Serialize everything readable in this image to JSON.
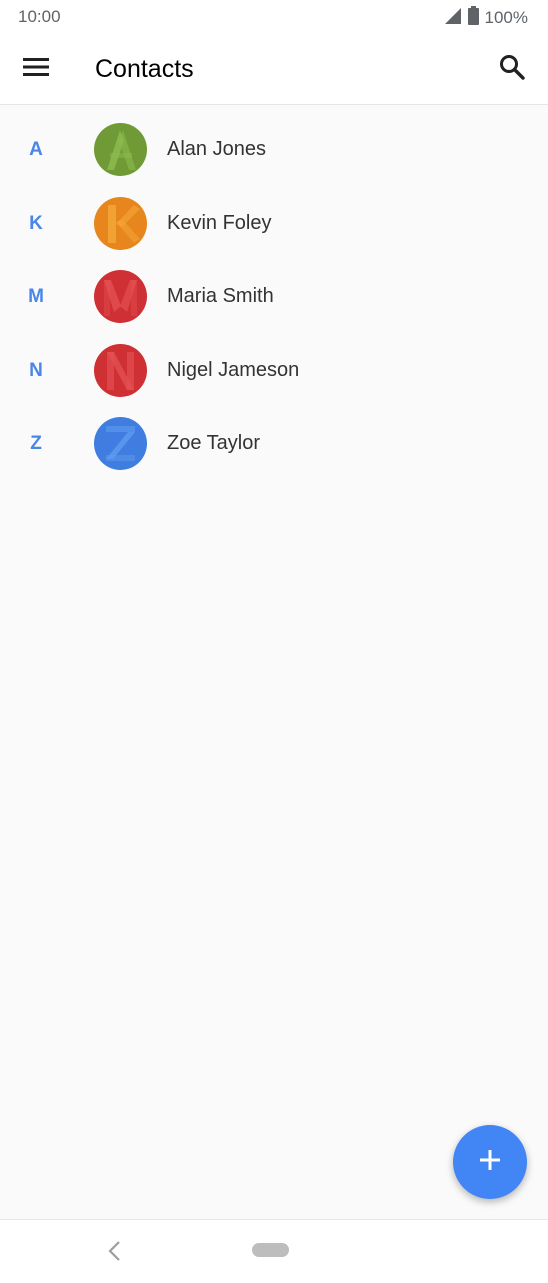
{
  "status_bar": {
    "time": "10:00",
    "battery": "100%",
    "icons": [
      "signal-icon",
      "battery-icon"
    ]
  },
  "app_bar": {
    "title": "Contacts",
    "icons": [
      "menu-icon",
      "search-icon"
    ]
  },
  "contacts": [
    {
      "index": "A",
      "name": "Alan Jones",
      "avatar_color": "#6f9a35",
      "avatar_light": "#8cbb4e"
    },
    {
      "index": "K",
      "name": "Kevin Foley",
      "avatar_color": "#e6861c",
      "avatar_light": "#f5a73a"
    },
    {
      "index": "M",
      "name": "Maria Smith",
      "avatar_color": "#cf3033",
      "avatar_light": "#e65456"
    },
    {
      "index": "N",
      "name": "Nigel Jameson",
      "avatar_color": "#cf3033",
      "avatar_light": "#e65456"
    },
    {
      "index": "Z",
      "name": "Zoe Taylor",
      "avatar_color": "#3f7de0",
      "avatar_light": "#5f9bf0"
    }
  ],
  "fab": {
    "icon": "plus-icon",
    "color": "#4285f4"
  },
  "nav_bar": {
    "icons": [
      "back-icon",
      "home-pill"
    ]
  },
  "colors": {
    "accent": "#4a86e8",
    "background": "#fafafa"
  }
}
